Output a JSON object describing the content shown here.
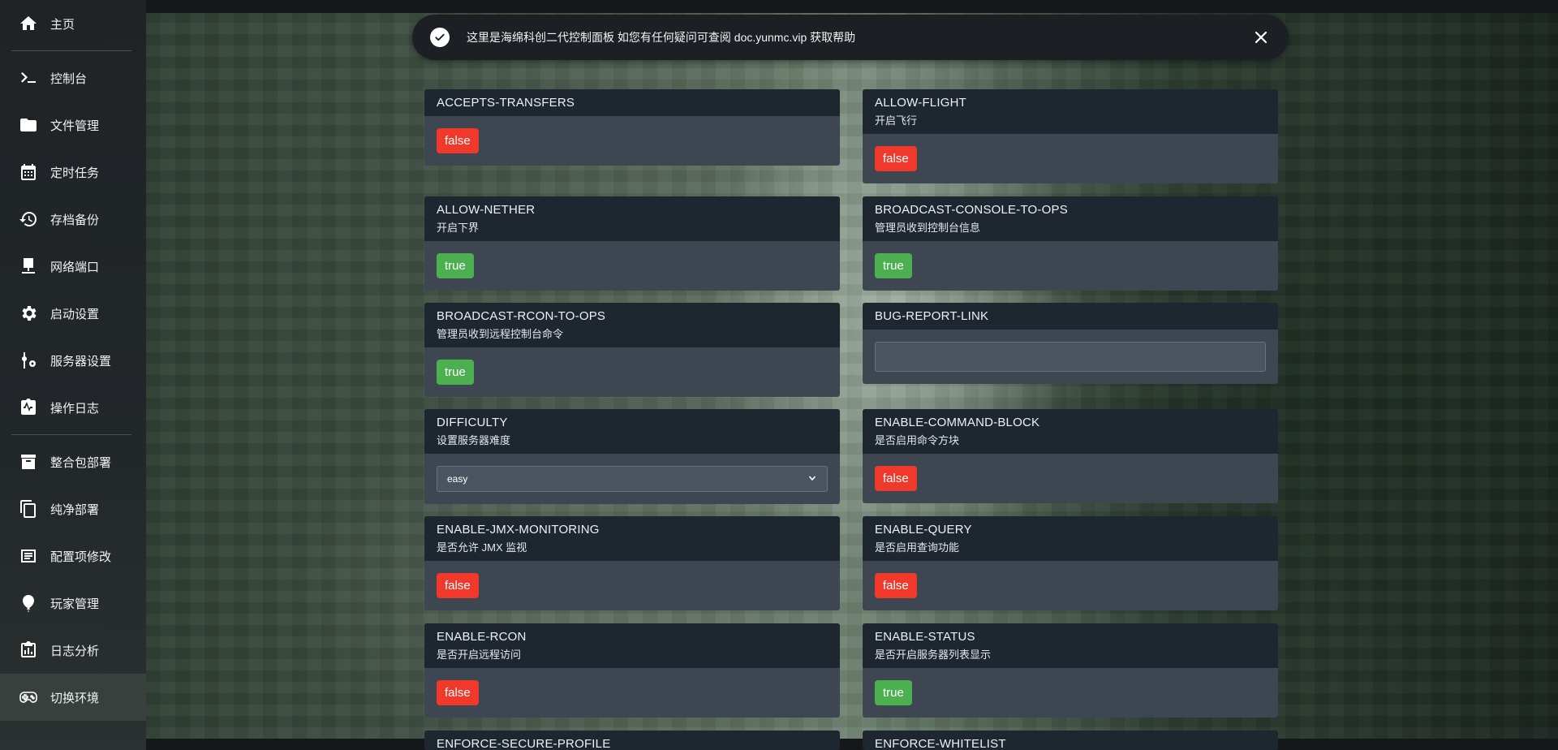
{
  "sidebar": {
    "items": [
      {
        "label": "主页",
        "icon": "home-icon"
      },
      {
        "label": "控制台",
        "icon": "terminal-icon"
      },
      {
        "label": "文件管理",
        "icon": "folder-icon"
      },
      {
        "label": "定时任务",
        "icon": "calendar-icon"
      },
      {
        "label": "存档备份",
        "icon": "history-icon"
      },
      {
        "label": "网络端口",
        "icon": "monitor-icon"
      },
      {
        "label": "启动设置",
        "icon": "gear-icon"
      },
      {
        "label": "服务器设置",
        "icon": "wrench-gear-icon"
      },
      {
        "label": "操作日志",
        "icon": "clipboard-pulse-icon"
      },
      {
        "label": "整合包部署",
        "icon": "archive-icon"
      },
      {
        "label": "纯净部署",
        "icon": "copy-icon"
      },
      {
        "label": "配置项修改",
        "icon": "list-box-icon"
      },
      {
        "label": "玩家管理",
        "icon": "balloon-icon"
      },
      {
        "label": "日志分析",
        "icon": "clipboard-chart-icon"
      },
      {
        "label": "切换环境",
        "icon": "gamepad-icon"
      }
    ]
  },
  "toast": {
    "message": "这里是海绵科创二代控制面板 如您有任何疑问可查阅 doc.yunmc.vip 获取帮助",
    "icon": "check-circle-icon",
    "close_icon": "close-icon"
  },
  "config": {
    "accepts_transfers": {
      "key": "ACCEPTS-TRANSFERS",
      "value": "false"
    },
    "allow_flight": {
      "key": "ALLOW-FLIGHT",
      "desc": "开启飞行",
      "value": "false"
    },
    "allow_nether": {
      "key": "ALLOW-NETHER",
      "desc": "开启下界",
      "value": "true"
    },
    "broadcast_console": {
      "key": "BROADCAST-CONSOLE-TO-OPS",
      "desc": "管理员收到控制台信息",
      "value": "true"
    },
    "broadcast_rcon": {
      "key": "BROADCAST-RCON-TO-OPS",
      "desc": "管理员收到远程控制台命令",
      "value": "true"
    },
    "bug_report_link": {
      "key": "BUG-REPORT-LINK",
      "value": ""
    },
    "difficulty": {
      "key": "DIFFICULTY",
      "desc": "设置服务器难度",
      "value": "easy"
    },
    "enable_command_block": {
      "key": "ENABLE-COMMAND-BLOCK",
      "desc": "是否启用命令方块",
      "value": "false"
    },
    "enable_jmx": {
      "key": "ENABLE-JMX-MONITORING",
      "desc": "是否允许 JMX 监视",
      "value": "false"
    },
    "enable_query": {
      "key": "ENABLE-QUERY",
      "desc": "是否启用查询功能",
      "value": "false"
    },
    "enable_rcon": {
      "key": "ENABLE-RCON",
      "desc": "是否开启远程访问",
      "value": "false"
    },
    "enable_status": {
      "key": "ENABLE-STATUS",
      "desc": "是否开启服务器列表显示",
      "value": "true"
    },
    "enforce_secure_profile": {
      "key": "ENFORCE-SECURE-PROFILE"
    },
    "enforce_whitelist": {
      "key": "ENFORCE-WHITELIST"
    }
  },
  "colors": {
    "false_badge": "#f0392b",
    "true_badge": "#4caf50",
    "card_head": "#1e2730",
    "card_body": "#3d4651"
  }
}
